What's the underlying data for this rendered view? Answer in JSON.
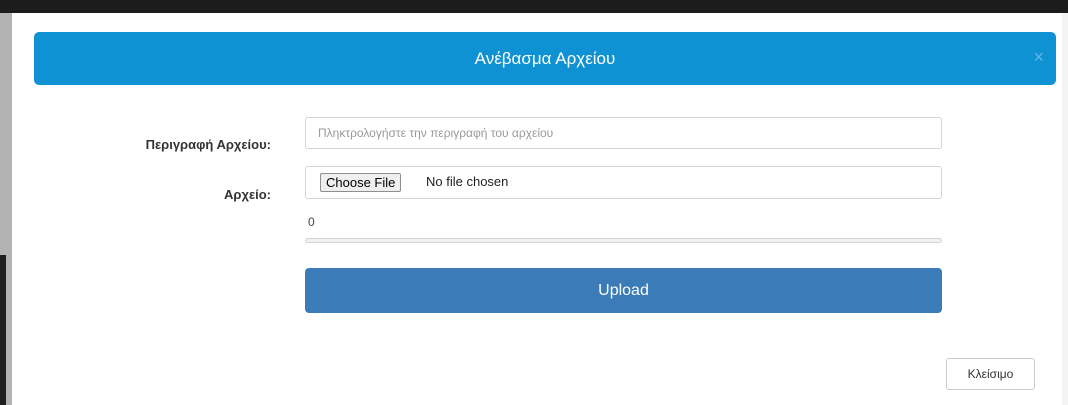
{
  "modal": {
    "title": "Ανέβασμα Αρχείου",
    "close_symbol": "×",
    "close_icon": "close-icon"
  },
  "form": {
    "description": {
      "label": "Περιγραφή Αρχείου:",
      "placeholder": "Πληκτρολογήστε την περιγραφή του αρχείου",
      "value": ""
    },
    "file": {
      "label": "Αρχείο:",
      "choose_label": "Choose File",
      "status": "No file chosen"
    },
    "progress": {
      "value_text": "0",
      "percent": 0
    },
    "upload_label": "Upload"
  },
  "footer": {
    "close_label": "Κλείσιμο"
  },
  "colors": {
    "header": "#0f92d3",
    "upload_button": "#3a7bb8"
  }
}
